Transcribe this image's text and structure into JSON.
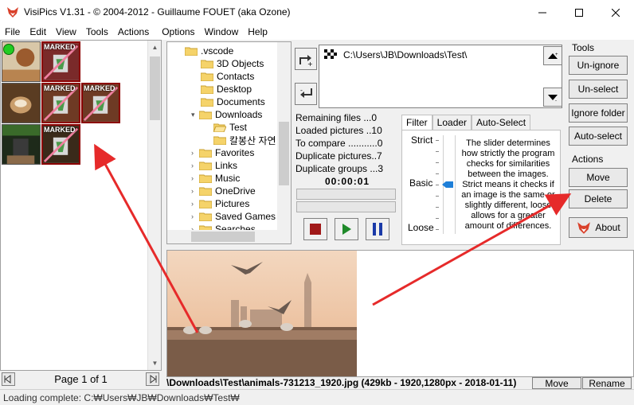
{
  "window": {
    "title": "VisiPics V1.31 - © 2004-2012 - Guillaume FOUET (aka Ozone)"
  },
  "menu": [
    "File",
    "Edit",
    "View",
    "Tools",
    "Actions",
    "Options",
    "Window",
    "Help"
  ],
  "thumbnails": {
    "marked_label": "MARKED"
  },
  "pager": {
    "label": "Page 1 of 1"
  },
  "status": {
    "text": "Loading complete: C:₩Users₩JB₩Downloads₩Test₩"
  },
  "folder_tree": {
    "items": [
      ".vscode",
      "3D Objects",
      "Contacts",
      "Desktop",
      "Documents",
      "Downloads",
      "Test",
      "칼봉산 자연",
      "Favorites",
      "Links",
      "Music",
      "OneDrive",
      "Pictures",
      "Saved Games",
      "Searches"
    ]
  },
  "paths": {
    "selected": "C:\\Users\\JB\\Downloads\\Test\\"
  },
  "stats": {
    "remaining": "Remaining files ...0",
    "loaded": "Loaded pictures ..10",
    "to_compare": "To compare ...........0",
    "duplicate_pictures": "Duplicate pictures..7",
    "duplicate_groups": "Duplicate groups ...3"
  },
  "timer": "00:00:01",
  "tabs": [
    "Filter",
    "Loader",
    "Auto-Select"
  ],
  "filter": {
    "strict": "Strict",
    "basic": "Basic",
    "loose": "Loose",
    "level": "Basic",
    "description": "The slider determines how strictly the program checks for similarities between the images. Strict means it checks if an image is the same or slightly different, loose allows for a greater amount of differences."
  },
  "tools": {
    "title": "Tools",
    "unignore": "Un-ignore",
    "unselect": "Un-select",
    "ignore_folder": "Ignore folder",
    "auto_select": "Auto-select"
  },
  "actions": {
    "title": "Actions",
    "move": "Move",
    "delete": "Delete",
    "about": "About"
  },
  "preview": {
    "file_info": "\\Downloads\\Test\\animals-731213_1920.jpg (429kb - 1920,1280px - 2018-01-11)",
    "move": "Move",
    "rename": "Rename"
  },
  "colors": {
    "marked_border": "#8b0000",
    "arrow_red": "#e62a2a",
    "accent_blue": "#1e7fd8"
  }
}
